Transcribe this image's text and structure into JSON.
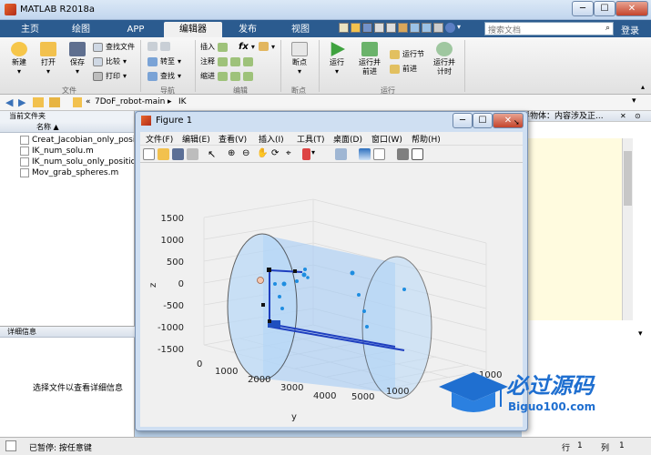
{
  "window": {
    "title": "MATLAB R2018a",
    "min": "─",
    "max": "☐",
    "close": "✕"
  },
  "tabs": [
    "主页",
    "绘图",
    "APP",
    "编辑器",
    "发布",
    "视图"
  ],
  "search_placeholder": "搜索文档",
  "login": "登录",
  "ribbon": {
    "file": {
      "label": "文件",
      "new": "新建",
      "open": "打开",
      "save": "保存",
      "find_files": "查找文件",
      "compare": "比较",
      "print": "打印"
    },
    "nav": {
      "label": "导航",
      "goto": "转至",
      "find": "查找"
    },
    "edit": {
      "label": "编辑",
      "insert": "插入",
      "comment": "注释",
      "indent": "缩进",
      "fx": "fx"
    },
    "breakpoint": {
      "label": "断点",
      "item": "断点"
    },
    "run": {
      "label": "运行",
      "run": "运行",
      "run_adv": "运行并\n前进",
      "run_section": "运行节",
      "advance": "前进",
      "run_time": "运行并\n计时"
    }
  },
  "address": {
    "path1": "7DoF_robot-main",
    "path2": "IK",
    "prefix": "«"
  },
  "current_folder": {
    "title": "当前文件夹",
    "col": "名称 ▲",
    "files": [
      "Creat_Jacobian_only_posit",
      "IK_num_solu.m",
      "IK_num_solu_only_position",
      "Mov_grab_spheres.m"
    ]
  },
  "details": {
    "title": "详细信息",
    "msg": "选择文件以查看详细信息"
  },
  "right_panel": {
    "title": "浮物体：内容涉及正..."
  },
  "status": {
    "msg": "已暂停: 按任意键",
    "row_label": "行",
    "row": "1",
    "col_label": "列",
    "col": "1"
  },
  "figure": {
    "title": "Figure 1",
    "menus": [
      "文件(F)",
      "编辑(E)",
      "查看(V)",
      "插入(I)",
      "工具(T)",
      "桌面(D)",
      "窗口(W)",
      "帮助(H)"
    ],
    "axes": {
      "z_ticks": [
        "1500",
        "1000",
        "500",
        "0",
        "-500",
        "-1000",
        "-1500"
      ],
      "y_ticks": [
        "0",
        "1000",
        "2000",
        "3000",
        "4000",
        "5000"
      ],
      "x_ticks": [
        "1000",
        "1000"
      ],
      "zlabel": "z",
      "ylabel": "y"
    }
  },
  "watermark": {
    "cn": "必过源码",
    "en": "Biguo100.com"
  },
  "colors": {
    "tabbar": "#2b5b8f",
    "cylinder": "#9ec9f5",
    "link": "#1f3fbf",
    "points": "#1e8de0"
  }
}
